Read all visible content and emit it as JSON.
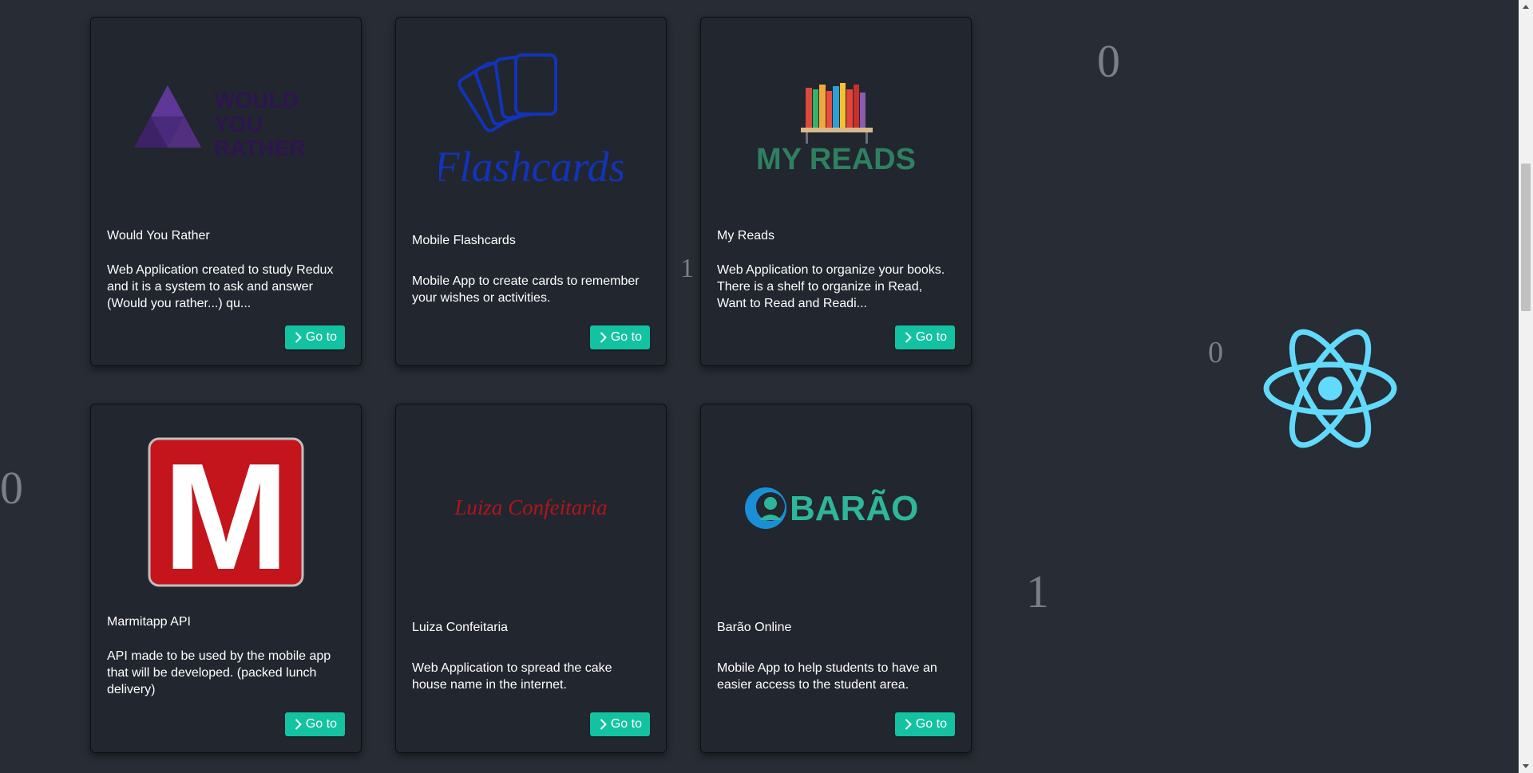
{
  "projects": [
    {
      "title": "Would You Rather",
      "description": "Web Application created to study Redux and it is a system to ask and answer (Would you rather...) qu...",
      "button_label": "Go to",
      "logo_text": [
        "WOULD",
        "YOU",
        "RATHER"
      ]
    },
    {
      "title": "Mobile Flashcards",
      "description": "Mobile App to create cards to remember your wishes or activities.",
      "button_label": "Go to",
      "logo_text": "Flashcards"
    },
    {
      "title": "My Reads",
      "description": "Web Application to organize your books. There is a shelf to organize in Read, Want to Read and Readi...",
      "button_label": "Go to",
      "logo_text": "MY READS"
    },
    {
      "title": "Marmitapp API",
      "description": "API made to be used by the mobile app that will be developed. (packed lunch delivery)",
      "button_label": "Go to",
      "logo_text": "M"
    },
    {
      "title": "Luiza Confeitaria",
      "description": "Web Application to spread the cake house name in the internet.",
      "button_label": "Go to",
      "logo_text": "Luiza Confeitaria"
    },
    {
      "title": "Barão Online",
      "description": "Mobile App to help students to have an easier access to the student area.",
      "button_label": "Go to",
      "logo_text": "BARÃO"
    }
  ],
  "background_digits": [
    "0",
    "1",
    "0",
    "0",
    "1"
  ],
  "colors": {
    "background": "#282c34",
    "card": "#22262e",
    "button": "#13c2a1",
    "react": "#61dafb",
    "digit": "#7a7f88"
  },
  "icons": {
    "button": "chevron-right-icon",
    "decoration": "react-logo"
  }
}
